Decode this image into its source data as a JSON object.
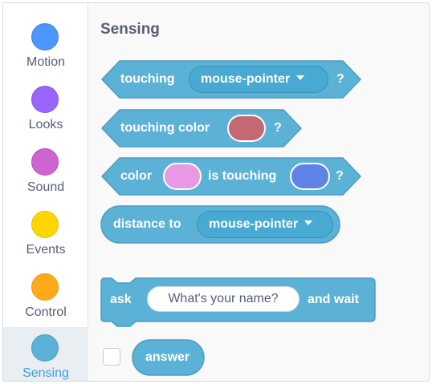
{
  "categories": [
    {
      "label": "Motion",
      "color": "#4c97ff",
      "active": false
    },
    {
      "label": "Looks",
      "color": "#9966ff",
      "active": false
    },
    {
      "label": "Sound",
      "color": "#cf63cf",
      "active": false
    },
    {
      "label": "Events",
      "color": "#ffd500",
      "active": false
    },
    {
      "label": "Control",
      "color": "#ffab19",
      "active": false
    },
    {
      "label": "Sensing",
      "color": "#5cb1d6",
      "active": true
    }
  ],
  "palette": {
    "title": "Sensing",
    "block_color": "#5cb1d6",
    "block_border": "#4a9ec2",
    "touching": {
      "label": "touching",
      "menu": "mouse-pointer",
      "suffix": "?"
    },
    "touching_color": {
      "label": "touching color",
      "swatch": "#c46874",
      "suffix": "?"
    },
    "color_touching": {
      "label": "color",
      "swatch1": "#e799e4",
      "middle": "is touching",
      "swatch2": "#5d84e6",
      "suffix": "?"
    },
    "distance_to": {
      "label": "distance to",
      "menu": "mouse-pointer"
    },
    "ask": {
      "label": "ask",
      "input": "What's your name?",
      "suffix": "and wait"
    },
    "answer": {
      "label": "answer",
      "checked": false
    }
  }
}
